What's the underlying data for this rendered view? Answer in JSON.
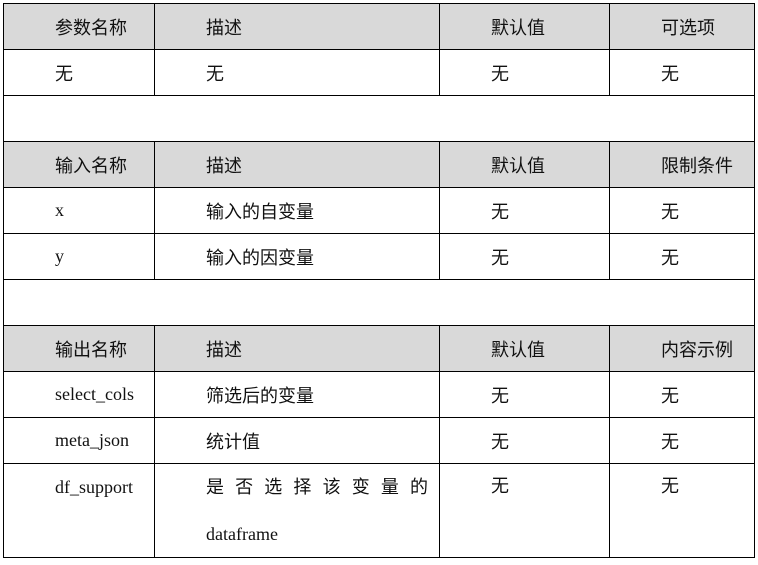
{
  "params_table": {
    "header": [
      "参数名称",
      "描述",
      "默认值",
      "可选项"
    ],
    "rows": [
      [
        "无",
        "无",
        "无",
        "无"
      ]
    ]
  },
  "input_table": {
    "header": [
      "输入名称",
      "描述",
      "默认值",
      "限制条件"
    ],
    "rows": [
      [
        "x",
        "输入的自变量",
        "无",
        "无"
      ],
      [
        "y",
        "输入的因变量",
        "无",
        "无"
      ]
    ]
  },
  "output_table": {
    "header": [
      "输出名称",
      "描述",
      "默认值",
      "内容示例"
    ],
    "rows": [
      [
        "select_cols",
        "筛选后的变量",
        "无",
        "无"
      ],
      [
        "meta_json",
        "统计值",
        "无",
        "无"
      ],
      [
        "df_support",
        "是否选择该变量的dataframe",
        "无",
        "无"
      ]
    ],
    "df_support_desc_line1": [
      "是",
      "否",
      "选",
      "择",
      "该",
      "变",
      "量",
      "的"
    ],
    "df_support_desc_line2": "dataframe"
  }
}
